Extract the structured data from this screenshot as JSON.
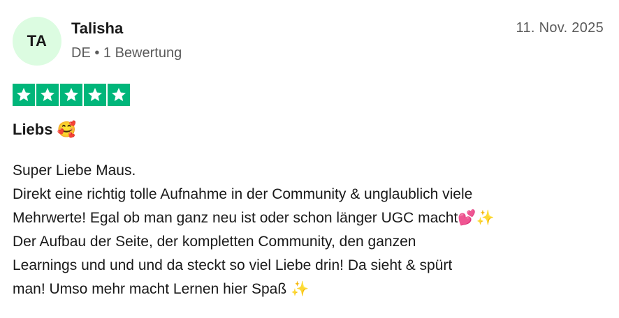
{
  "reviewer": {
    "initials": "TA",
    "name": "Talisha",
    "meta": "DE • 1 Bewertung"
  },
  "date": "11. Nov. 2025",
  "rating": {
    "stars": 5,
    "max": 5,
    "color": "#00b67a"
  },
  "review": {
    "title": "Liebs 🥰",
    "lines": [
      "Super Liebe Maus.",
      "Direkt eine richtig tolle Aufnahme in der Community & unglaublich viele",
      "Mehrwerte! Egal ob man ganz neu ist oder schon länger UGC macht💕✨",
      "Der Aufbau der Seite, der kompletten Community, den ganzen",
      "Learnings und und und da steckt so viel Liebe drin! Da sieht & spürt",
      "man! Umso mehr macht Lernen hier Spaß ✨"
    ]
  }
}
